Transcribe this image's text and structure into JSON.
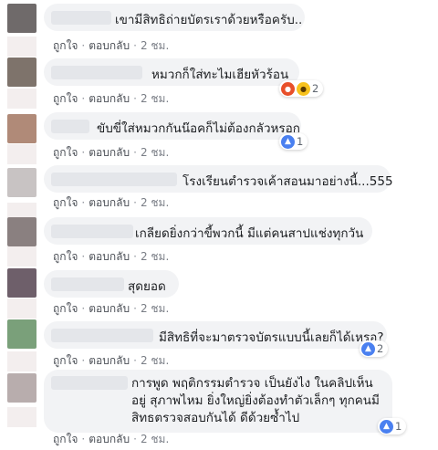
{
  "time_ago": "2 ชม.",
  "actions": {
    "like": "ถูกใจ",
    "reply": "ตอบกลับ"
  },
  "comments": [
    {
      "text": "เขามีสิทธิถ่ายบัตรเราด้วยหรือครับ..",
      "avatar_color": "#6f6a6a"
    },
    {
      "text": "หมวกก็ใส่ทะไมเฮียหัวร้อน",
      "avatar_color": "#7e736b",
      "reactions": {
        "icons": [
          "angry-icon",
          "haha-icon"
        ],
        "count": "2"
      }
    },
    {
      "text": "ขับขี่ใส่หมวกกันน๊อคก็ไม่ต้องกลัวหรอก",
      "avatar_color": "#b08a78",
      "reactions": {
        "icons": [
          "like-icon"
        ],
        "count": "1"
      }
    },
    {
      "text": "โรงเรียนตำรวจเค้าสอนมาอย่างนี้...555",
      "avatar_color": "#c8c3c3"
    },
    {
      "text": "เกลียดยิ่งกว่าขี้พวกนี้ มีแต่คนสาปแช่งทุกวัน",
      "avatar_color": "#8a8080"
    },
    {
      "text": "สุดยอด",
      "avatar_color": "#6e5f6a"
    },
    {
      "text": "มีสิทธิที่จะมาตรวจบัตรแบบนี้เลยก็ได้เหรอ?",
      "avatar_color": "#7aa07a",
      "reactions": {
        "icons": [
          "like-icon"
        ],
        "count": "2"
      }
    },
    {
      "text": "การพูด พฤติกรรมตำรวจ เป็นยังไง ในคลิปเห็นอยู่ สุภาพไหม ยิ่งใหญ่ยิ่งต้องทำตัวเล็กๆ ทุกคนมีสิทธตรวจสอบกันได้ ดีด้วยซ้ำไป",
      "avatar_color": "#b8adad",
      "reactions": {
        "icons": [
          "like-icon"
        ],
        "count": "1"
      }
    }
  ]
}
